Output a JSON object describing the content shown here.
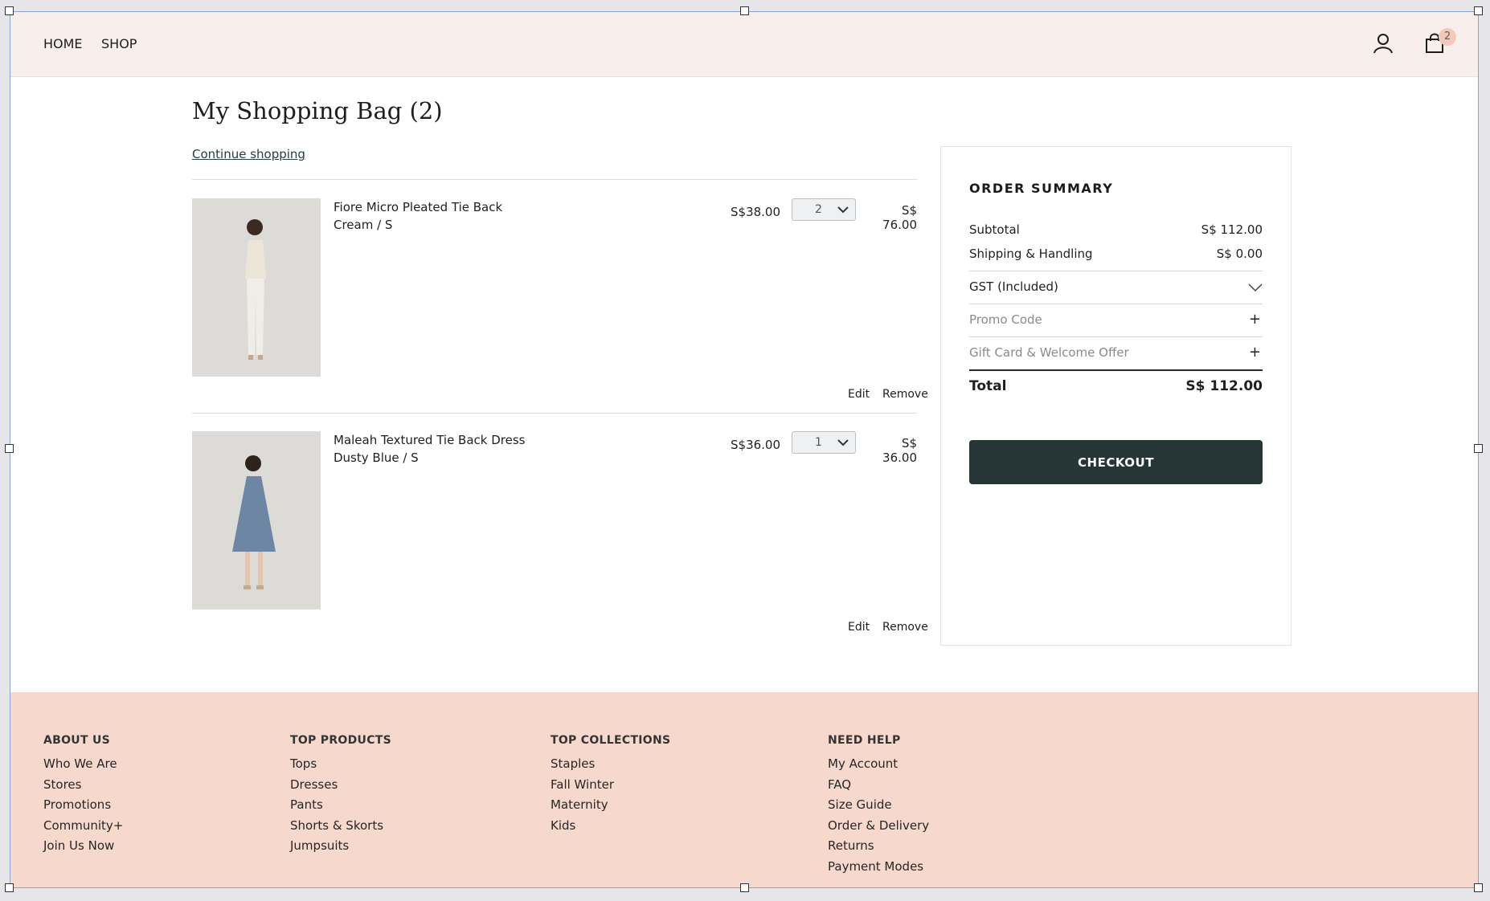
{
  "nav": {
    "home": "HOME",
    "shop": "SHOP",
    "cart_count": "2"
  },
  "bag": {
    "title": "My Shopping Bag (2)",
    "continue": "Continue shopping",
    "items": [
      {
        "name": "Fiore Micro Pleated Tie Back",
        "variant": "Cream / S",
        "unit_price": "S$38.00",
        "qty": "2",
        "total": "S$ 76.00",
        "edit": "Edit",
        "remove": "Remove",
        "image_color": "#ece6d8"
      },
      {
        "name": "Maleah Textured Tie Back Dress",
        "variant": "Dusty Blue / S",
        "unit_price": "S$36.00",
        "qty": "1",
        "total": "S$ 36.00",
        "edit": "Edit",
        "remove": "Remove",
        "image_color": "#6d86a3"
      }
    ]
  },
  "summary": {
    "title": "ORDER SUMMARY",
    "subtotal_label": "Subtotal",
    "subtotal_value": "S$ 112.00",
    "shipping_label": "Shipping & Handling",
    "shipping_value": "S$ 0.00",
    "gst_label": "GST (Included)",
    "promo_label": "Promo Code",
    "gift_label": "Gift Card & Welcome Offer",
    "total_label": "Total",
    "total_value": "S$ 112.00",
    "checkout": "CHECKOUT"
  },
  "footer": {
    "columns": [
      {
        "heading": "ABOUT US",
        "links": [
          "Who We Are",
          "Stores",
          "Promotions",
          "Community+",
          "Join Us Now"
        ]
      },
      {
        "heading": "TOP PRODUCTS",
        "links": [
          "Tops",
          "Dresses",
          "Pants",
          "Shorts & Skorts",
          "Jumpsuits"
        ]
      },
      {
        "heading": "TOP COLLECTIONS",
        "links": [
          "Staples",
          "Fall Winter",
          "Maternity",
          "Kids"
        ]
      },
      {
        "heading": "NEED HELP",
        "links": [
          "My Account",
          "FAQ",
          "Size Guide",
          "Order & Delivery",
          "Returns",
          "Payment Modes"
        ]
      }
    ]
  },
  "colors": {
    "header_bg": "#f8efec",
    "footer_bg": "#f6d8cc",
    "checkout_bg": "#263535"
  }
}
